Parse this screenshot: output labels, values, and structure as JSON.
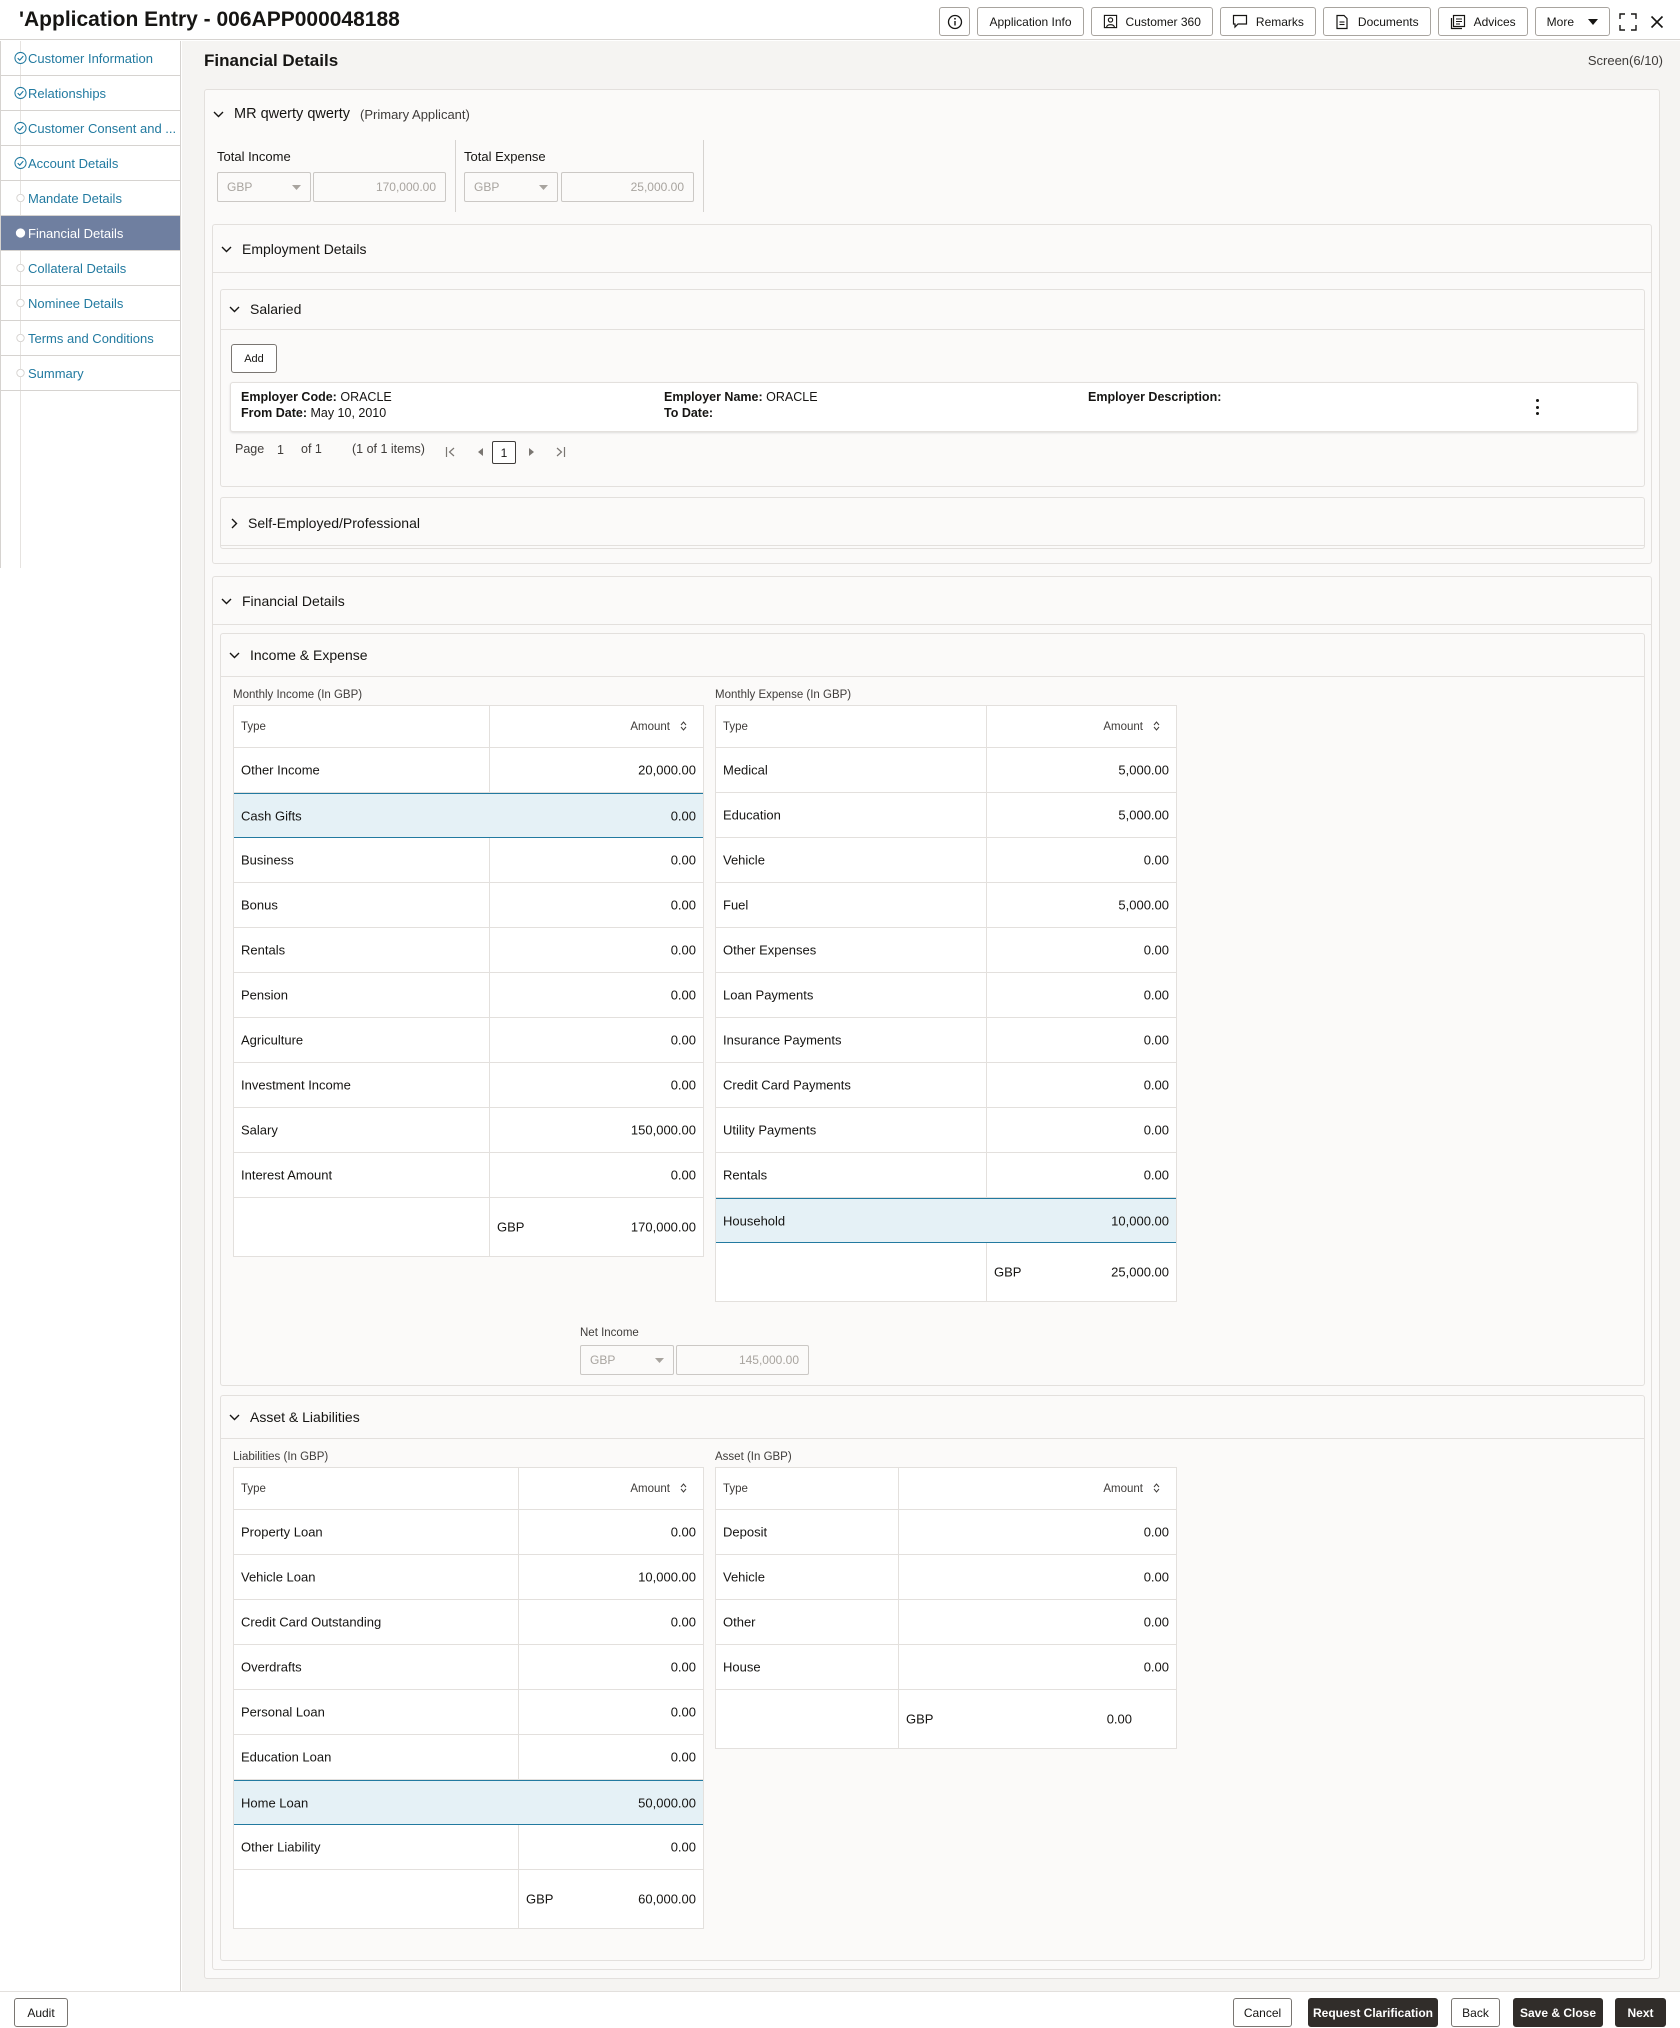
{
  "header": {
    "title": "'Application Entry - 006APP000048188",
    "buttons": {
      "application_info": "Application Info",
      "customer_360": "Customer 360",
      "remarks": "Remarks",
      "documents": "Documents",
      "advices": "Advices",
      "more": "More"
    }
  },
  "sidebar": {
    "items": [
      {
        "label": "Customer Information",
        "state": "completed"
      },
      {
        "label": "Relationships",
        "state": "completed"
      },
      {
        "label": "Customer Consent and ...",
        "state": "completed"
      },
      {
        "label": "Account Details",
        "state": "completed"
      },
      {
        "label": "Mandate Details",
        "state": "pending"
      },
      {
        "label": "Financial Details",
        "state": "active"
      },
      {
        "label": "Collateral Details",
        "state": "pending"
      },
      {
        "label": "Nominee Details",
        "state": "pending"
      },
      {
        "label": "Terms and Conditions",
        "state": "pending"
      },
      {
        "label": "Summary",
        "state": "pending"
      }
    ]
  },
  "page": {
    "title": "Financial Details",
    "screen": "Screen(6/10)"
  },
  "applicant": {
    "name": "MR qwerty qwerty",
    "role": "(Primary Applicant)",
    "total_income_label": "Total Income",
    "total_income_currency": "GBP",
    "total_income_amount": "170,000.00",
    "total_expense_label": "Total Expense",
    "total_expense_currency": "GBP",
    "total_expense_amount": "25,000.00"
  },
  "employment": {
    "title": "Employment Details",
    "salaried_title": "Salaried",
    "add_label": "Add",
    "record": {
      "employer_code_label": "Employer Code:",
      "employer_code": "ORACLE",
      "employer_name_label": "Employer Name:",
      "employer_name": "ORACLE",
      "employer_desc_label": "Employer Description:",
      "from_date_label": "From Date:",
      "from_date": "May 10, 2010",
      "to_date_label": "To Date:"
    },
    "pager": {
      "page_label": "Page",
      "page_value": "1",
      "of_label": "of 1",
      "items_label": "(1 of 1 items)",
      "current": "1"
    },
    "self_employed_title": "Self-Employed/Professional"
  },
  "financial": {
    "title": "Financial Details",
    "income_expense_title": "Income & Expense",
    "monthly_income": {
      "caption": "Monthly Income (In GBP)",
      "col_type": "Type",
      "col_amount": "Amount",
      "rows": [
        {
          "type": "Other Income",
          "amount": "20,000.00"
        },
        {
          "type": "Cash Gifts",
          "amount": "0.00"
        },
        {
          "type": "Business",
          "amount": "0.00"
        },
        {
          "type": "Bonus",
          "amount": "0.00"
        },
        {
          "type": "Rentals",
          "amount": "0.00"
        },
        {
          "type": "Pension",
          "amount": "0.00"
        },
        {
          "type": "Agriculture",
          "amount": "0.00"
        },
        {
          "type": "Investment Income",
          "amount": "0.00"
        },
        {
          "type": "Salary",
          "amount": "150,000.00"
        },
        {
          "type": "Interest Amount",
          "amount": "0.00"
        }
      ],
      "total_currency": "GBP",
      "total_amount": "170,000.00"
    },
    "monthly_expense": {
      "caption": "Monthly Expense (In GBP)",
      "col_type": "Type",
      "col_amount": "Amount",
      "rows": [
        {
          "type": "Medical",
          "amount": "5,000.00"
        },
        {
          "type": "Education",
          "amount": "5,000.00"
        },
        {
          "type": "Vehicle",
          "amount": "0.00"
        },
        {
          "type": "Fuel",
          "amount": "5,000.00"
        },
        {
          "type": "Other Expenses",
          "amount": "0.00"
        },
        {
          "type": "Loan Payments",
          "amount": "0.00"
        },
        {
          "type": "Insurance Payments",
          "amount": "0.00"
        },
        {
          "type": "Credit Card Payments",
          "amount": "0.00"
        },
        {
          "type": "Utility Payments",
          "amount": "0.00"
        },
        {
          "type": "Rentals",
          "amount": "0.00"
        },
        {
          "type": "Household",
          "amount": "10,000.00"
        }
      ],
      "total_currency": "GBP",
      "total_amount": "25,000.00"
    },
    "net_income": {
      "label": "Net Income",
      "currency": "GBP",
      "amount": "145,000.00"
    },
    "asset_liabilities_title": "Asset & Liabilities",
    "liabilities": {
      "caption": "Liabilities (In GBP)",
      "col_type": "Type",
      "col_amount": "Amount",
      "rows": [
        {
          "type": "Property Loan",
          "amount": "0.00"
        },
        {
          "type": "Vehicle Loan",
          "amount": "10,000.00"
        },
        {
          "type": "Credit Card Outstanding",
          "amount": "0.00"
        },
        {
          "type": "Overdrafts",
          "amount": "0.00"
        },
        {
          "type": "Personal Loan",
          "amount": "0.00"
        },
        {
          "type": "Education Loan",
          "amount": "0.00"
        },
        {
          "type": "Home Loan",
          "amount": "50,000.00"
        },
        {
          "type": "Other Liability",
          "amount": "0.00"
        }
      ],
      "total_currency": "GBP",
      "total_amount": "60,000.00"
    },
    "assets": {
      "caption": "Asset (In GBP)",
      "col_type": "Type",
      "col_amount": "Amount",
      "rows": [
        {
          "type": "Deposit",
          "amount": "0.00"
        },
        {
          "type": "Vehicle",
          "amount": "0.00"
        },
        {
          "type": "Other",
          "amount": "0.00"
        },
        {
          "type": "House",
          "amount": "0.00"
        }
      ],
      "total_currency": "GBP",
      "total_amount": "0.00"
    }
  },
  "footer": {
    "audit": "Audit",
    "cancel": "Cancel",
    "request_clarification": "Request Clarification",
    "back": "Back",
    "save_close": "Save & Close",
    "next": "Next"
  }
}
